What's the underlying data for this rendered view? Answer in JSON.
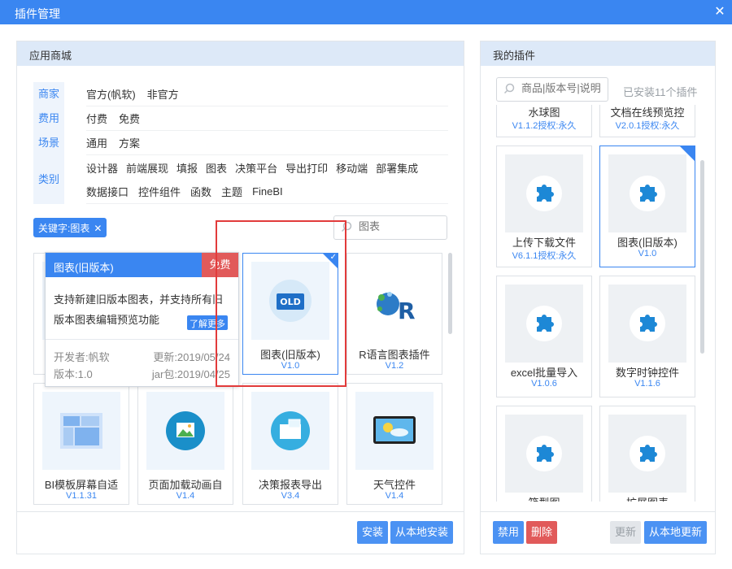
{
  "window": {
    "title": "插件管理",
    "close_icon": "close-icon"
  },
  "store": {
    "header": "应用商城",
    "filters": [
      {
        "key": "商家",
        "values": [
          "官方(帆软)",
          "非官方"
        ]
      },
      {
        "key": "费用",
        "values": [
          "付费",
          "免费"
        ]
      },
      {
        "key": "场景",
        "values": [
          "通用",
          "方案"
        ]
      },
      {
        "key": "类别",
        "values": [
          "设计器",
          "前端展现",
          "填报",
          "图表",
          "决策平台",
          "导出打印",
          "移动端",
          "部署集成"
        ]
      },
      {
        "key": "",
        "values": [
          "数据接口",
          "控件组件",
          "函数",
          "主题",
          "FineBI"
        ]
      }
    ],
    "keyword_tag": "关键字:图表",
    "search_placeholder": "图表",
    "tooltip": {
      "title": "图表(旧版本)",
      "badge": "免费",
      "description": "支持新建旧版本图表，并支持所有旧版本图表编辑预览功能",
      "more": "了解更多",
      "developer": "开发者:帆软",
      "updated": "更新:2019/05/24",
      "version": "版本:1.0",
      "jar": "jar包:2019/04/25"
    },
    "cards": [
      {
        "name": "图表(旧版本)",
        "version": "V1.0",
        "selected": true,
        "icon": "old-chart-icon"
      },
      {
        "name": "R语言图表插件",
        "version": "V1.2",
        "selected": false,
        "icon": "r-language-icon"
      },
      {
        "name": "BI模板屏幕自适",
        "version": "V1.1.31",
        "selected": false,
        "icon": "layout-grid-icon"
      },
      {
        "name": "页面加载动画自",
        "version": "V1.4",
        "selected": false,
        "icon": "image-icon"
      },
      {
        "name": "决策报表导出",
        "version": "V3.4",
        "selected": false,
        "icon": "export-icon"
      },
      {
        "name": "天气控件",
        "version": "V1.4",
        "selected": false,
        "icon": "weather-icon"
      }
    ],
    "buttons": {
      "install": "安装",
      "local_install": "从本地安装"
    }
  },
  "mine": {
    "header": "我的插件",
    "search_placeholder": "商品|版本号|说明",
    "installed_count": "已安装11个插件",
    "items": [
      {
        "name": "水球图",
        "version": "V1.1.2授权:永久"
      },
      {
        "name": "文档在线预览控",
        "version": "V2.0.1授权:永久"
      },
      {
        "name": "上传下载文件",
        "version": "V6.1.1授权:永久"
      },
      {
        "name": "图表(旧版本)",
        "version": "V1.0",
        "selected": true
      },
      {
        "name": "excel批量导入",
        "version": "V1.0.6"
      },
      {
        "name": "数字时钟控件",
        "version": "V1.1.6"
      },
      {
        "name": "箱型图",
        "version": ""
      },
      {
        "name": "扩展图表",
        "version": ""
      }
    ],
    "buttons": {
      "disable": "禁用",
      "delete": "删除",
      "update": "更新",
      "local_update": "从本地更新"
    }
  },
  "colors": {
    "accent": "#3a86f1",
    "danger": "#e15a5a",
    "panel_header": "#dde9f8"
  }
}
